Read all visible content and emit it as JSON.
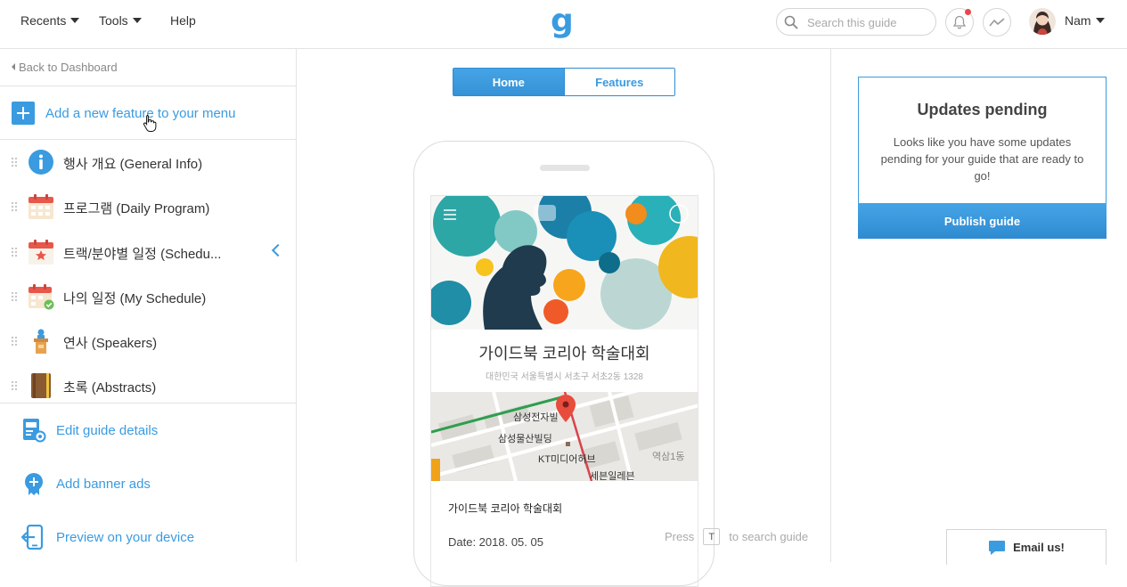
{
  "header": {
    "nav": [
      {
        "label": "Recents",
        "has_caret": true
      },
      {
        "label": "Tools",
        "has_caret": true
      },
      {
        "label": "Help",
        "has_caret": false
      }
    ],
    "logo": "g",
    "search_placeholder": "Search this guide",
    "user_name": "Nam",
    "icons": [
      "search-icon",
      "bell-icon",
      "activity-icon",
      "chevron-down-icon"
    ]
  },
  "sidebar": {
    "back_label": "Back to Dashboard",
    "add_feature_label": "Add a new feature to your menu",
    "items": [
      {
        "label": "행사 개요 (General Info)",
        "icon": "info-icon"
      },
      {
        "label": "프로그램 (Daily Program)",
        "icon": "calendar-icon"
      },
      {
        "label": "트랙/분야별 일정 (Schedu...",
        "icon": "calendar-star-icon"
      },
      {
        "label": "나의 일정 (My Schedule)",
        "icon": "calendar-check-icon"
      },
      {
        "label": "연사 (Speakers)",
        "icon": "podium-icon"
      },
      {
        "label": "초록 (Abstracts)",
        "icon": "book-icon"
      }
    ],
    "actions": [
      {
        "label": "Edit guide details",
        "icon": "edit-guide-icon"
      },
      {
        "label": "Add banner ads",
        "icon": "banner-ads-icon"
      },
      {
        "label": "Preview on your device",
        "icon": "device-preview-icon"
      }
    ]
  },
  "center": {
    "tabs": [
      {
        "label": "Home",
        "active": true
      },
      {
        "label": "Features",
        "active": false
      }
    ],
    "preview": {
      "guide_title": "가이드북 코리아 학술대회",
      "address": "대한민국 서울특별시 서초구 서초2동 1328",
      "map_labels": [
        "삼성전자빌",
        "삼성물산빌딩",
        "KT미디어허브",
        "역삼1동",
        "세븐일레븐"
      ],
      "info_title": "가이드북 코리아 학술대회",
      "date": "Date: 2018. 05. 05"
    },
    "hint": {
      "before": "Press",
      "key": "T",
      "after": "to search guide"
    }
  },
  "right": {
    "updates_title": "Updates pending",
    "updates_text": "Looks like you have some updates pending for your guide that are ready to go!",
    "publish_label": "Publish guide",
    "email_label": "Email us!"
  },
  "colors": {
    "accent": "#3a9be0",
    "notification": "#e8474d"
  }
}
